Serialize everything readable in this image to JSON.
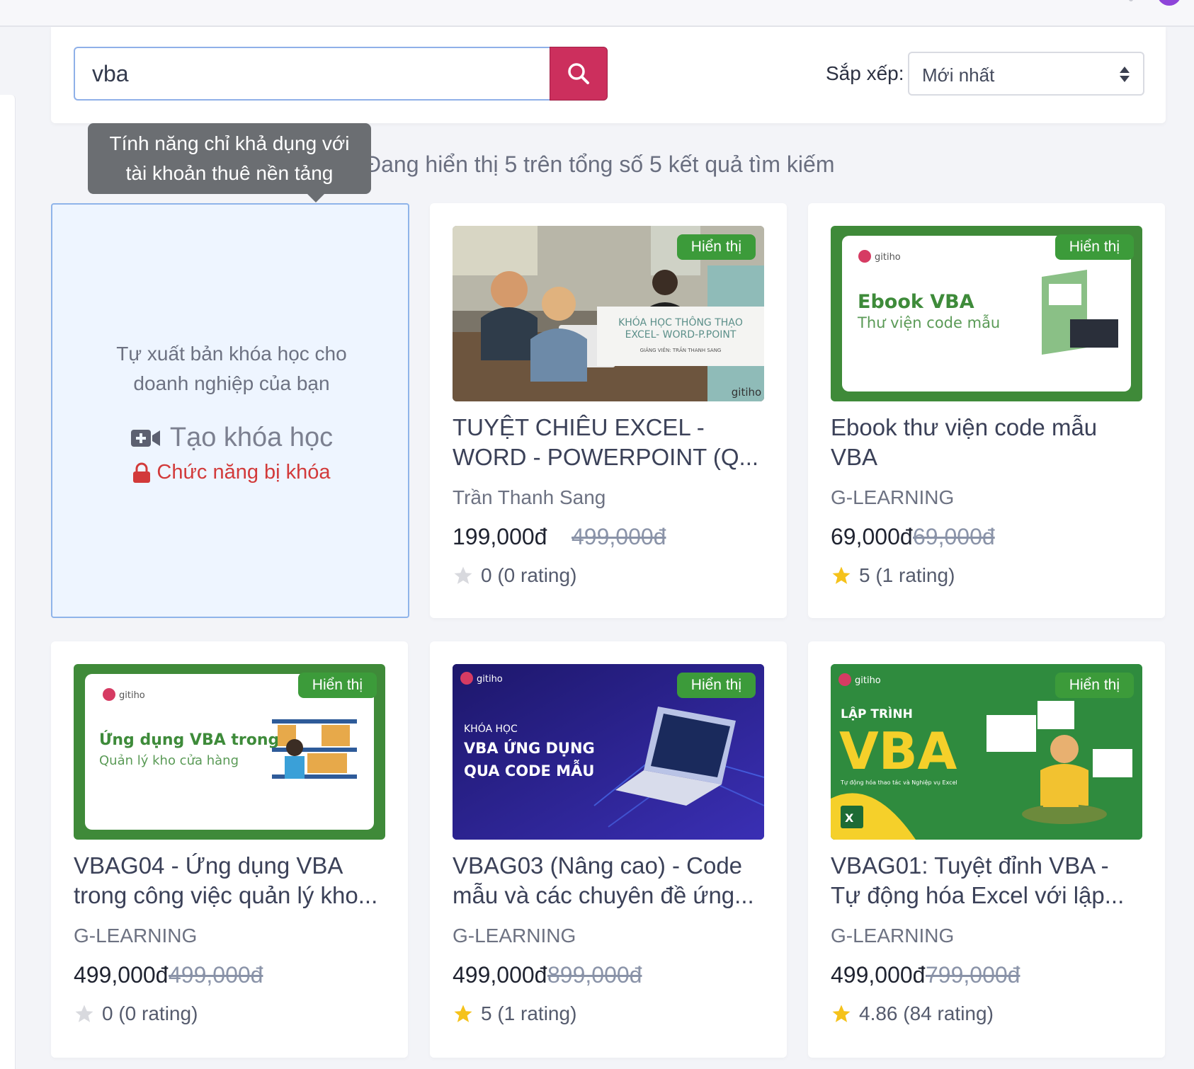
{
  "search": {
    "value": "vba"
  },
  "sort": {
    "label": "Sắp xếp:",
    "selected": "Mới nhất"
  },
  "results_text": "Đang hiển thị 5 trên tổng số 5 kết quả tìm kiếm",
  "tooltip": {
    "line1": "Tính năng chỉ khả dụng với",
    "line2": "tài khoản thuê nền tảng"
  },
  "create_card": {
    "line1": "Tự xuất bản khóa học cho",
    "line2": "doanh nghiệp của bạn",
    "button_label": "Tạo khóa học",
    "locked_label": "Chức năng bị khóa"
  },
  "badge_label": "Hiển thị",
  "courses": [
    {
      "title": "TUYỆT CHIÊU EXCEL - WORD - POWERPOINT (Q...",
      "author": "Trần Thanh Sang",
      "price": "199,000đ",
      "old_price": "499,000đ",
      "rating": "0 (0 rating)",
      "rated": false,
      "thumb": {
        "line1": "KHÓA HỌC THÔNG THẠO",
        "line2": "EXCEL- WORD-P.POINT",
        "line3": "GIẢNG VIÊN: TRẦN THANH SANG",
        "brand": "gitiho"
      }
    },
    {
      "title": "Ebook thư viện code mẫu VBA",
      "author": "G-LEARNING",
      "price": "69,000đ",
      "old_price": "69,000đ",
      "rating": "5 (1 rating)",
      "rated": true,
      "thumb": {
        "brand": "gitiho",
        "heading": "Ebook VBA",
        "sub": "Thư viện code mẫu"
      }
    },
    {
      "title": "VBAG04 - Ứng dụng VBA trong công việc quản lý kho...",
      "author": "G-LEARNING",
      "price": "499,000đ",
      "old_price": "499,000đ",
      "rating": "0 (0 rating)",
      "rated": false,
      "thumb": {
        "brand": "gitiho",
        "heading": "Ứng dụng VBA trong",
        "sub": "Quản lý kho cửa hàng"
      }
    },
    {
      "title": "VBAG03 (Nâng cao) - Code mẫu và các chuyên đề ứng...",
      "author": "G-LEARNING",
      "price": "499,000đ",
      "old_price": "899,000đ",
      "rating": "5 (1 rating)",
      "rated": true,
      "thumb": {
        "brand": "gitiho",
        "small": "KHÓA HỌC",
        "line1": "VBA ỨNG DỤNG",
        "line2": "QUA CODE MẪU"
      }
    },
    {
      "title": "VBAG01: Tuyệt đỉnh VBA - Tự động hóa Excel với lập...",
      "author": "G-LEARNING",
      "price": "499,000đ",
      "old_price": "799,000đ",
      "rating": "4.86 (84 rating)",
      "rated": true,
      "thumb": {
        "brand": "gitiho",
        "small": "LẬP TRÌNH",
        "big": "VBA",
        "sub": "Tự động hóa thao tác và Nghiệp vụ Excel"
      }
    }
  ],
  "colors": {
    "accent_red": "#cc2f5d",
    "badge_green": "#3c9b3a",
    "locked_red": "#d23a3a",
    "star_gold": "#f5c21b",
    "star_gray": "#d8d9de"
  }
}
